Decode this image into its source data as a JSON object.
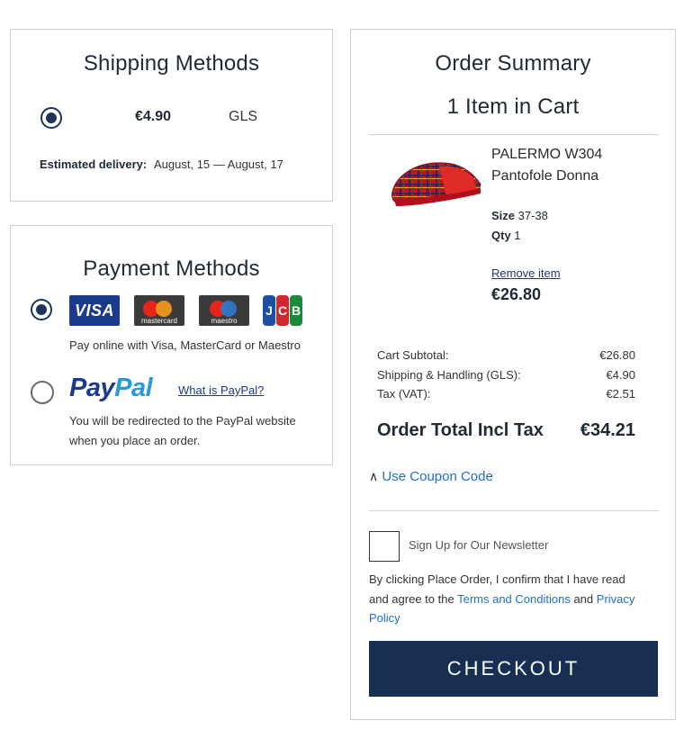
{
  "shipping": {
    "title": "Shipping Methods",
    "price": "€4.90",
    "carrier": "GLS",
    "estimated_label": "Estimated delivery:",
    "estimated_value": "August, 15 — August, 17"
  },
  "payment": {
    "title": "Payment Methods",
    "cards": {
      "visa": "VISA",
      "mastercard": "mastercard",
      "maestro": "maestro",
      "jcb_j": "J",
      "jcb_c": "C",
      "jcb_b": "B"
    },
    "card_description": "Pay online with Visa, MasterCard or Maestro",
    "paypal_logo_pay": "Pay",
    "paypal_logo_pal": "Pal",
    "paypal_link": "What is PayPal?",
    "paypal_description_line1": "You will be redirected to the PayPal website",
    "paypal_description_line2": "when you place an order."
  },
  "summary": {
    "title": "Order Summary",
    "items_count": "1 Item in Cart",
    "product": {
      "name_line1": "PALERMO W304",
      "name_line2": "Pantofole Donna",
      "size_label": "Size",
      "size_value": "37-38",
      "qty_label": "Qty",
      "qty_value": "1",
      "remove_label": "Remove item",
      "price": "€26.80"
    },
    "totals": {
      "subtotal_label": "Cart Subtotal:",
      "subtotal_value": "€26.80",
      "shipping_label": "Shipping & Handling (GLS):",
      "shipping_value": "€4.90",
      "tax_label": "Tax (VAT):",
      "tax_value": "€2.51",
      "order_total_label": "Order Total Incl Tax",
      "order_total_value": "€34.21"
    },
    "coupon_label": "Use Coupon Code",
    "newsletter_label": "Sign Up for Our Newsletter",
    "terms": {
      "line1": "By clicking Place Order, I confirm that I have read",
      "line2_prefix": "and agree to the",
      "terms_link": "Terms and Conditions",
      "and": "and",
      "privacy_link_part1": "Privacy",
      "privacy_link_part2": "Policy"
    },
    "checkout_label": "CHECKOUT"
  },
  "colors": {
    "primary_dark": "#182f54",
    "link_blue": "#1e6fc8",
    "paypal_dark_blue": "#1b3a8b",
    "paypal_light_blue": "#2a9ad6"
  }
}
